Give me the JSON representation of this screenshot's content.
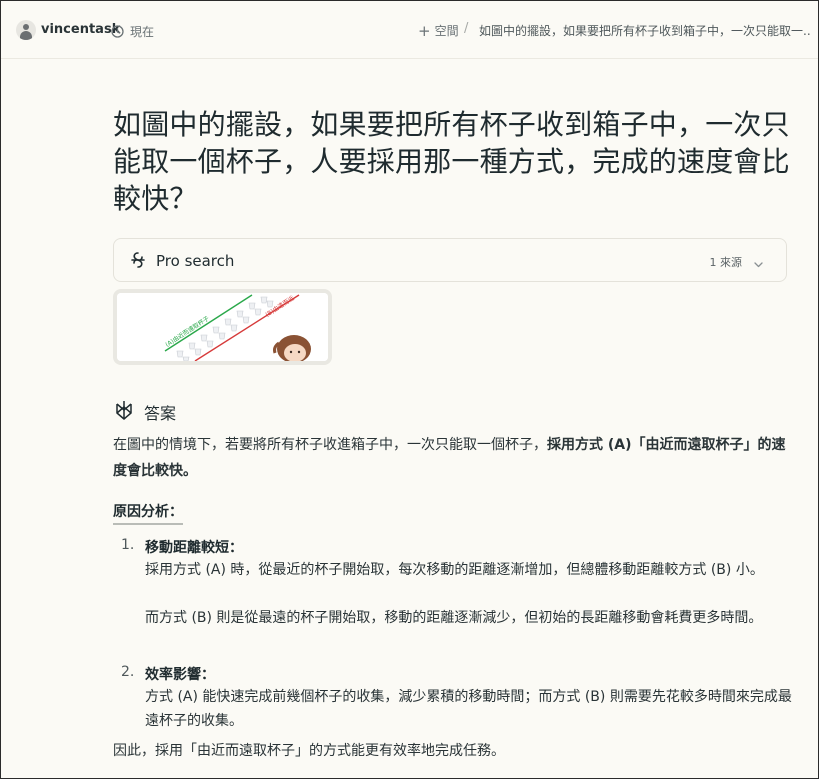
{
  "header": {
    "username": "vincentask",
    "time": "現在",
    "space_label": "空間",
    "breadcrumb_title": "如圖中的擺設，如果要把所有杯子收到箱子中，一次只能取一..."
  },
  "question": {
    "title": "如圖中的擺設，如果要把所有杯子收到箱子中，一次只能取一個杯子，人要採用那一種方式，完成的速度會比較快？"
  },
  "pro_search": {
    "label": "Pro search",
    "source_count": "1 來源"
  },
  "thumbnail": {
    "label_a": "(A)由近而遠取杯子",
    "label_b": "(B)由遠而近"
  },
  "answer": {
    "heading": "答案",
    "intro_plain": "在圖中的情境下，若要將所有杯子收進箱子中，一次只能取一個杯子，",
    "intro_bold": "採用方式 (A)「由近而遠取杯子」",
    "intro_tail": "的速度會比較快。",
    "reason_heading": "原因分析：",
    "items": [
      {
        "num": "1.",
        "title": "移動距離較短：",
        "lines": [
          "採用方式 (A) 時，從最近的杯子開始取，每次移動的距離逐漸增加，但總體移動距離較方式 (B) 小。",
          "而方式 (B) 則是從最遠的杯子開始取，移動的距離逐漸減少，但初始的長距離移動會耗費更多時間。"
        ]
      },
      {
        "num": "2.",
        "title": "效率影響：",
        "lines": [
          "方式 (A) 能快速完成前幾個杯子的收集，減少累積的移動時間；而方式 (B) 則需要先花較多時間來完成最遠杯子的收集。"
        ]
      }
    ],
    "conclusion": "因此，採用「由近而遠取杯子」的方式能更有效率地完成任務。"
  },
  "colors": {
    "background": "#fbfaf5",
    "text": "#1f2b2f",
    "muted": "#6a7275",
    "green_line": "#2aa84a",
    "red_line": "#d63a3a"
  }
}
